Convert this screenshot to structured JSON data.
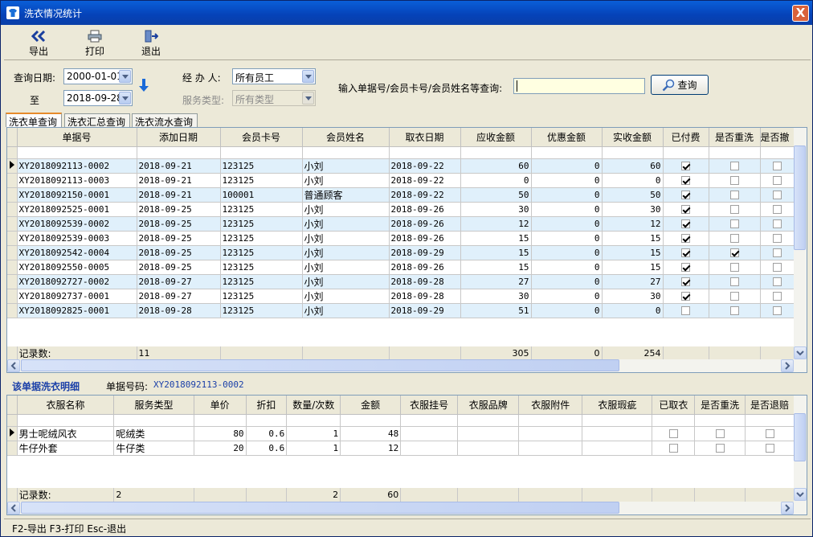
{
  "window": {
    "title": "洗衣情况统计",
    "close_label": "X"
  },
  "toolbar": {
    "export": "导出",
    "print": "打印",
    "exit": "退出"
  },
  "filter": {
    "date_label": "查询日期:",
    "date_from": "2000-01-01",
    "to_label": "至",
    "date_to": "2018-09-28",
    "handler_label": "经 办 人:",
    "handler_value": "所有员工",
    "service_label": "服务类型:",
    "service_value": "所有类型",
    "search_label": "输入单据号/会员卡号/会员姓名等查询:",
    "search_value": "",
    "search_button": "查询"
  },
  "tabs": [
    "洗衣单查询",
    "洗衣汇总查询",
    "洗衣流水查询"
  ],
  "orders": {
    "columns": [
      "单据号",
      "添加日期",
      "会员卡号",
      "会员姓名",
      "取衣日期",
      "应收金额",
      "优惠金额",
      "实收金额",
      "已付费",
      "是否重洗",
      "是否撤"
    ],
    "rows": [
      {
        "no": "XY2018092113-0002",
        "date": "2018-09-21",
        "card": "123125",
        "name": "小刘",
        "pick": "2018-09-22",
        "due": "60",
        "disc": "0",
        "paid_amt": "60",
        "paid": true,
        "rewash": false,
        "cancel": false
      },
      {
        "no": "XY2018092113-0003",
        "date": "2018-09-21",
        "card": "123125",
        "name": "小刘",
        "pick": "2018-09-22",
        "due": "0",
        "disc": "0",
        "paid_amt": "0",
        "paid": true,
        "rewash": false,
        "cancel": false
      },
      {
        "no": "XY2018092150-0001",
        "date": "2018-09-21",
        "card": "100001",
        "name": "普通顾客",
        "pick": "2018-09-22",
        "due": "50",
        "disc": "0",
        "paid_amt": "50",
        "paid": true,
        "rewash": false,
        "cancel": false
      },
      {
        "no": "XY2018092525-0001",
        "date": "2018-09-25",
        "card": "123125",
        "name": "小刘",
        "pick": "2018-09-26",
        "due": "30",
        "disc": "0",
        "paid_amt": "30",
        "paid": true,
        "rewash": false,
        "cancel": false
      },
      {
        "no": "XY2018092539-0002",
        "date": "2018-09-25",
        "card": "123125",
        "name": "小刘",
        "pick": "2018-09-26",
        "due": "12",
        "disc": "0",
        "paid_amt": "12",
        "paid": true,
        "rewash": false,
        "cancel": false
      },
      {
        "no": "XY2018092539-0003",
        "date": "2018-09-25",
        "card": "123125",
        "name": "小刘",
        "pick": "2018-09-26",
        "due": "15",
        "disc": "0",
        "paid_amt": "15",
        "paid": true,
        "rewash": false,
        "cancel": false
      },
      {
        "no": "XY2018092542-0004",
        "date": "2018-09-25",
        "card": "123125",
        "name": "小刘",
        "pick": "2018-09-29",
        "due": "15",
        "disc": "0",
        "paid_amt": "15",
        "paid": true,
        "rewash": true,
        "cancel": false
      },
      {
        "no": "XY2018092550-0005",
        "date": "2018-09-25",
        "card": "123125",
        "name": "小刘",
        "pick": "2018-09-26",
        "due": "15",
        "disc": "0",
        "paid_amt": "15",
        "paid": true,
        "rewash": false,
        "cancel": false
      },
      {
        "no": "XY2018092727-0002",
        "date": "2018-09-27",
        "card": "123125",
        "name": "小刘",
        "pick": "2018-09-28",
        "due": "27",
        "disc": "0",
        "paid_amt": "27",
        "paid": true,
        "rewash": false,
        "cancel": false
      },
      {
        "no": "XY2018092737-0001",
        "date": "2018-09-27",
        "card": "123125",
        "name": "小刘",
        "pick": "2018-09-28",
        "due": "30",
        "disc": "0",
        "paid_amt": "30",
        "paid": true,
        "rewash": false,
        "cancel": false
      },
      {
        "no": "XY2018092825-0001",
        "date": "2018-09-28",
        "card": "123125",
        "name": "小刘",
        "pick": "2018-09-29",
        "due": "51",
        "disc": "0",
        "paid_amt": "0",
        "paid": false,
        "rewash": false,
        "cancel": false
      }
    ],
    "footer": {
      "label": "记录数:",
      "count": "11",
      "due_total": "305",
      "disc_total": "0",
      "paid_total": "254"
    }
  },
  "detail": {
    "title": "该单据洗衣明细",
    "no_label": "单据号码:",
    "no_value": "XY2018092113-0002",
    "columns": [
      "衣服名称",
      "服务类型",
      "单价",
      "折扣",
      "数量/次数",
      "金额",
      "衣服挂号",
      "衣服品牌",
      "衣服附件",
      "衣服瑕疵",
      "已取衣",
      "是否重洗",
      "是否退赔"
    ],
    "rows": [
      {
        "name": "男士呢绒风衣",
        "type": "呢绒类",
        "price": "80",
        "disc": "0.6",
        "qty": "1",
        "amt": "48",
        "taken": false,
        "rewash": false,
        "refund": false
      },
      {
        "name": "牛仔外套",
        "type": "牛仔类",
        "price": "20",
        "disc": "0.6",
        "qty": "1",
        "amt": "12",
        "taken": false,
        "rewash": false,
        "refund": false
      }
    ],
    "footer": {
      "label": "记录数:",
      "count": "2",
      "qty_total": "2",
      "amt_total": "60"
    }
  },
  "status": "F2-导出 F3-打印 Esc-退出"
}
